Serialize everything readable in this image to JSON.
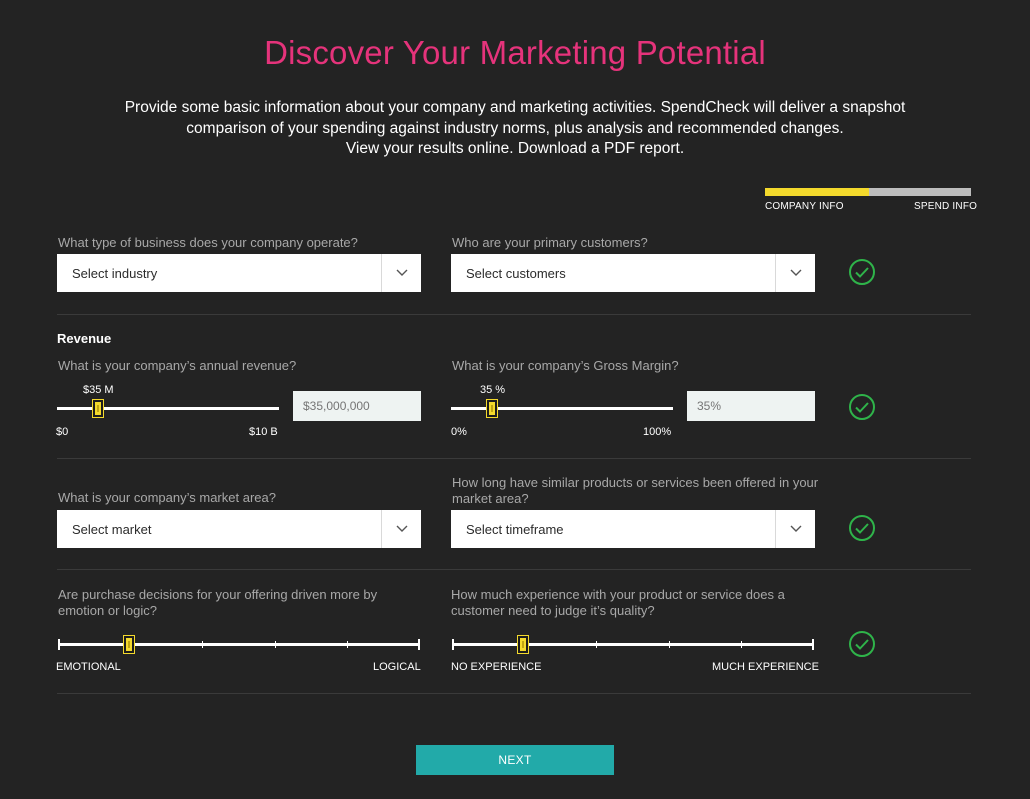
{
  "header": {
    "title": "Discover Your Marketing Potential",
    "intro_line1": "Provide some basic information about your company and marketing activities. SpendCheck will deliver a snapshot",
    "intro_line2": "comparison of your spending against industry norms, plus analysis and recommended changes.",
    "intro_line3": "View your results online. Download a PDF report."
  },
  "progress": {
    "step1": "COMPANY INFO",
    "step2": "SPEND INFO",
    "complete_fraction": 0.5,
    "colors": {
      "done": "#f3d92c",
      "todo": "#bdbdbd"
    }
  },
  "row1": {
    "business_question": "What type of business does your company operate?",
    "business_value": "Select industry",
    "customers_question": "Who are your primary customers?",
    "customers_value": "Select customers"
  },
  "revenue": {
    "section_title": "Revenue",
    "annual_question": "What is your company’s annual revenue?",
    "annual_slider_value": "$35 M",
    "annual_min": "$0",
    "annual_max": "$10 B",
    "annual_placeholder": "$35,000,000",
    "margin_question": "What is your company’s Gross Margin?",
    "margin_slider_value": "35 %",
    "margin_min": "0%",
    "margin_max": "100%",
    "margin_placeholder": "35%"
  },
  "row3": {
    "market_question": "What is your company’s market area?",
    "market_value": "Select market",
    "timeframe_question_line1": "How long have similar products or services been offered in your",
    "timeframe_question_line2": "market area?",
    "timeframe_value": "Select timeframe"
  },
  "row4": {
    "emotion_question_line1": "Are purchase decisions for your offering driven more by",
    "emotion_question_line2": "emotion or logic?",
    "emotion_min": "EMOTIONAL",
    "emotion_max": "LOGICAL",
    "experience_question_line1": "How much experience with your product or service does a",
    "experience_question_line2": "customer need to judge it’s quality?",
    "experience_min": "NO EXPERIENCE",
    "experience_max": "MUCH EXPERIENCE"
  },
  "footer": {
    "next_label": "NEXT"
  },
  "colors": {
    "accent_pink": "#e5337b",
    "check_green": "#2fb44a",
    "slider_thumb": "#f3d92c",
    "button_teal": "#22aaa9"
  },
  "icons": [
    "chevron-down-icon",
    "check-circle-icon"
  ]
}
